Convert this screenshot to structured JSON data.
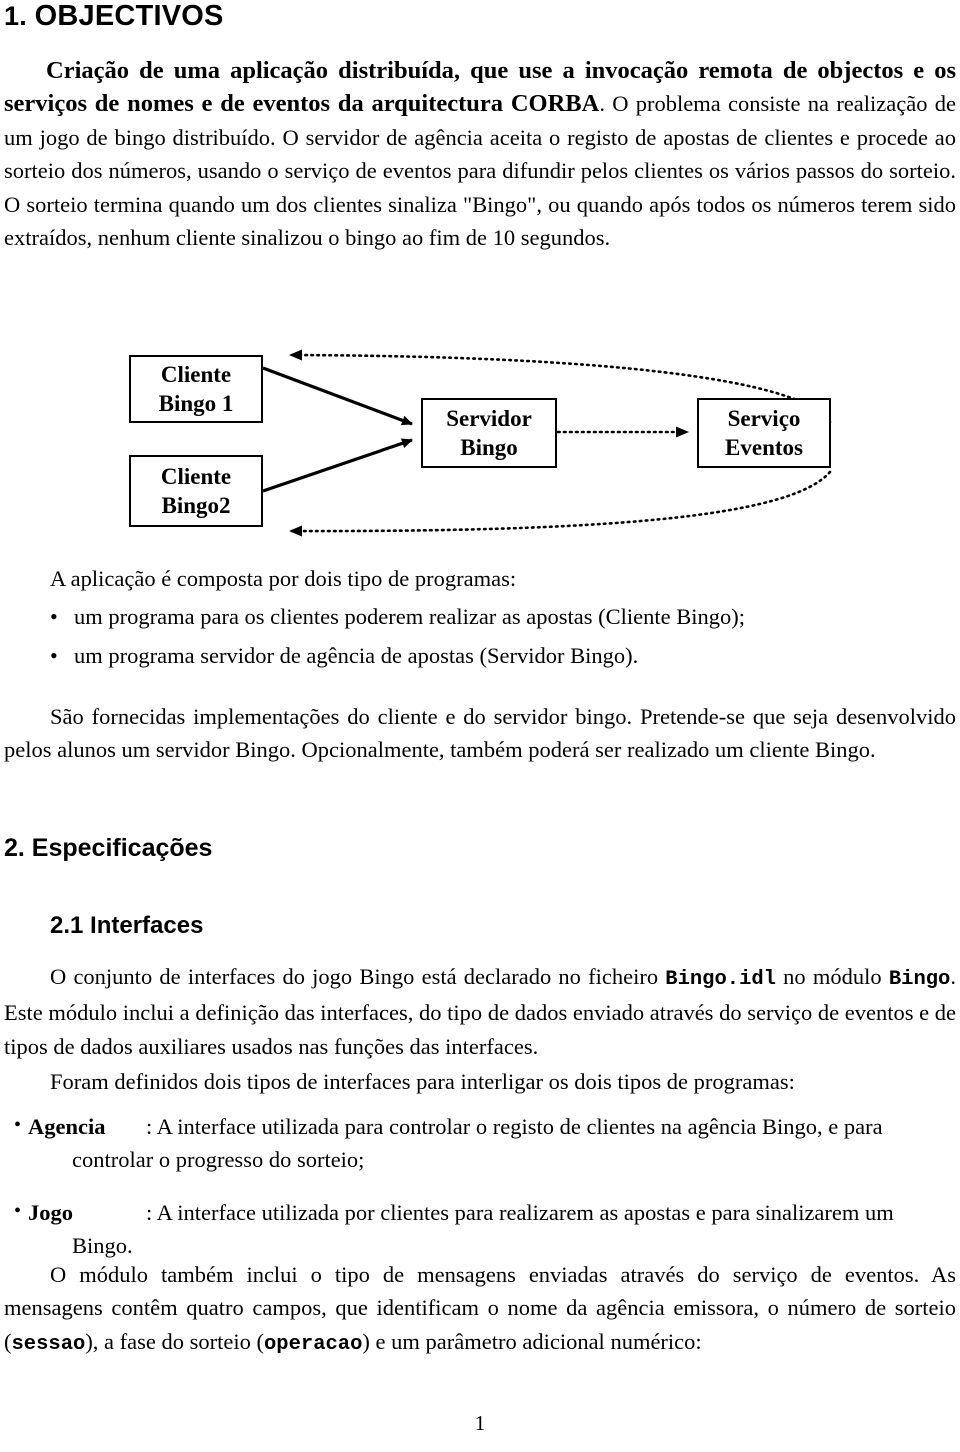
{
  "document": {
    "page_number": "1"
  },
  "sections": {
    "objectivos": {
      "number": "1.",
      "title": "OBJECTIVOS",
      "intro_bold": "Criação de uma aplicação distribuída, que use a invocação remota de objectos e os serviços de nomes e de eventos da arquitectura CORBA",
      "intro_rest": ". O problema consiste na realização de um jogo de bingo distribuído. O servidor de agência aceita o registo de apostas de clientes e procede ao sorteio dos números, usando o serviço de eventos para difundir pelos clientes os vários passos do sorteio. O sorteio termina quando um dos clientes sinaliza \"Bingo\", ou quando após todos os números terem sido extraídos, nenhum cliente sinalizou o bingo ao fim de 10 segundos."
    },
    "programas": {
      "lead": "A aplicação é composta por dois tipo de programas:",
      "items": [
        "um programa para os clientes poderem realizar as apostas (Cliente Bingo);",
        "um programa servidor de agência de apostas (Servidor Bingo)."
      ],
      "closing": "São fornecidas implementações do cliente e do servidor bingo. Pretende-se que seja desenvolvido pelos alunos um servidor Bingo. Opcionalmente, também poderá ser realizado um cliente Bingo."
    },
    "especificacoes": {
      "number": "2.",
      "title": "2. Especificações"
    },
    "interfaces": {
      "title": "2.1 Interfaces",
      "para1_a": "O conjunto de interfaces do jogo Bingo está declarado no ficheiro ",
      "para1_code1": "Bingo.idl",
      "para1_b": " no módulo ",
      "para1_code2": "Bingo",
      "para1_c": ". Este módulo inclui a definição das interfaces, do tipo de dados enviado através do serviço de eventos e de tipos de dados auxiliares usados nas funções das interfaces.",
      "para2": "Foram definidos dois tipos de interfaces para interligar os dois tipos de programas:",
      "items": [
        {
          "name": "Agencia",
          "text": ": A interface utilizada para controlar o registo de clientes na agência Bingo, e para",
          "continuation": "controlar o progresso do sorteio;"
        },
        {
          "name": "Jogo",
          "text": ": A interface utilizada por clientes para realizarem as apostas e para sinalizarem um",
          "continuation": "Bingo."
        }
      ],
      "para3_a": "O módulo também inclui o tipo de mensagens enviadas através do serviço de eventos. As mensagens contêm quatro campos, que identificam o nome da agência emissora, o número de sorteio (",
      "para3_code1": "sessao",
      "para3_b": "), a fase do sorteio (",
      "para3_code2": "operacao",
      "para3_c": ") e um parâmetro adicional numérico:"
    }
  },
  "diagram": {
    "boxes": {
      "cliente1_line1": "Cliente",
      "cliente1_line2": "Bingo 1",
      "cliente2_line1": "Cliente",
      "cliente2_line2": "Bingo2",
      "servidor_line1": "Servidor",
      "servidor_line2": "Bingo",
      "eventos_line1": "Serviço",
      "eventos_line2": "Eventos"
    },
    "stroke_color": "#000000"
  }
}
